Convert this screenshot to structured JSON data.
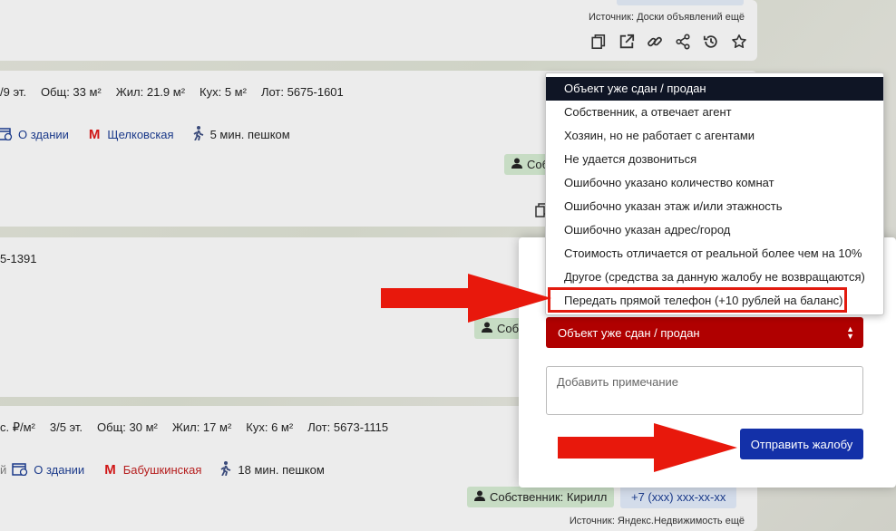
{
  "colors": {
    "accent_red": "#b00000",
    "submit_blue": "#1330a8",
    "annotation_red": "#e8180c",
    "selected_bg": "#0f1525"
  },
  "card1": {
    "source": "Источник: Доски объявлений ещё",
    "icons": [
      "copy-icon",
      "external-link-icon",
      "link-icon",
      "share-icon",
      "history-icon",
      "star-icon"
    ]
  },
  "card2": {
    "details": [
      "/9 эт.",
      "Общ: 33 м²",
      "Жил: 21.9 м²",
      "Кух: 5 м²",
      "Лот: 5675-1601"
    ],
    "building_link": "О здании",
    "metro": "Щелковская",
    "walk": "5 мин. пешком",
    "owner": "Собст"
  },
  "card3": {
    "details": [
      "5-1391"
    ],
    "owner": "Собствен"
  },
  "card4": {
    "details": [
      "с. ₽/м²",
      "3/5 эт.",
      "Общ: 30 м²",
      "Жил: 17 м²",
      "Кух: 6 м²",
      "Лот: 5673-1115"
    ],
    "prefix": "й",
    "building_link": "О здании",
    "metro": "Бабушкинская",
    "walk": "18 мин. пешком",
    "owner": "Собственник: Кирилл",
    "phone": "+7 (xxx) xxx-xx-xx",
    "source": "Источник: Яндекс.Недвижимость ещё"
  },
  "complaint": {
    "selected_reason": "Объект уже сдан / продан",
    "note_placeholder": "Добавить примечание",
    "submit_label": "Отправить жалобу",
    "options": [
      "Объект уже сдан / продан",
      "Собственник, а отвечает агент",
      "Хозяин, но не работает с агентами",
      "Не удается дозвониться",
      "Ошибочно указано количество комнат",
      "Ошибочно указан этаж и/или этажность",
      "Ошибочно указан адрес/город",
      "Стоимость отличается от реальной более чем на 10%",
      "Другое (средства за данную жалобу не возвращаются)",
      "Передать прямой телефон (+10 рублей на баланс)"
    ]
  }
}
